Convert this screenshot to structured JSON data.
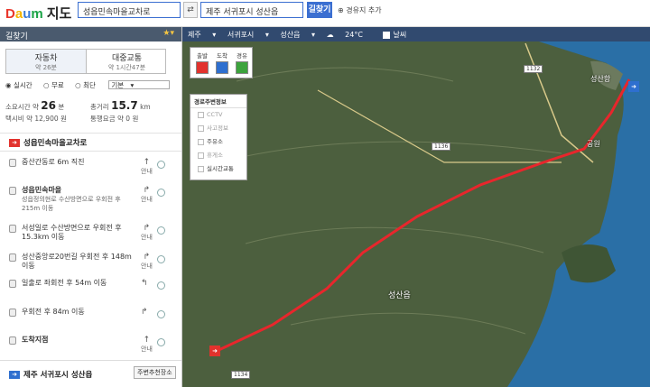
{
  "header": {
    "logo": {
      "d": "D",
      "a": "a",
      "u": "u",
      "m": "m"
    },
    "title": "지도",
    "origin_value": "성읍민속마을교차로",
    "destination_value": "제주 서귀포시 성산읍",
    "swap_icon": "swap-icon",
    "search_label": "길찾기",
    "add_waypoint_label": "경유지 추가"
  },
  "panel": {
    "title": "길찾기",
    "modes": [
      {
        "label": "자동차",
        "sub": "약 26분"
      },
      {
        "label": "대중교통",
        "sub": "약 1시간47분"
      }
    ],
    "options": {
      "realtime": "실시간",
      "free": "무료",
      "shortest": "최단",
      "select": "기본"
    },
    "stats": {
      "time_label": "소요시간",
      "time_pre": "약",
      "time_value": "26",
      "time_unit": "분",
      "dist_label": "총거리",
      "dist_value": "15.7",
      "dist_unit": "km",
      "taxi_label": "택시비",
      "taxi_value": "약 12,900 원",
      "toll_label": "통행요금",
      "toll_value": "약 0 원"
    },
    "start": "성읍민속마을교차로",
    "steps": [
      {
        "text": "중산간동로 6m 직진",
        "sub": "",
        "turn": "안내"
      },
      {
        "text": "성읍민속마을",
        "sub": "성읍정의현로 수산방면으로 우회전 후 215m 이동",
        "turn": "안내"
      },
      {
        "text": "서성일로 수산방면으로 우회전 후 15.3km 이동",
        "sub": "",
        "turn": "안내"
      },
      {
        "text": "성산중앙로20번길 우회전 후 148m 이동",
        "sub": "",
        "turn": "안내"
      },
      {
        "text": "일출로 좌회전 후 54m 이동",
        "sub": "",
        "turn": ""
      },
      {
        "text": "우회전 후 84m 이동",
        "sub": "",
        "turn": ""
      },
      {
        "text": "도착지점",
        "sub": "",
        "turn": "안내"
      }
    ],
    "end": "제주 서귀포시 성산읍",
    "nearby_label": "주변추천장소"
  },
  "map": {
    "topbar": {
      "region": "제주",
      "city": "서귀포시",
      "town": "성산읍",
      "weather": "24°C",
      "toggle": "날씨"
    },
    "legend": [
      "출발",
      "도착",
      "경유"
    ],
    "layer_title": "경로주변정보",
    "layers": [
      "CCTV",
      "사고정보",
      "주유소",
      "휴게소",
      "실시간교통"
    ],
    "labels": {
      "seongsan_port": "성산항",
      "park": "공원",
      "town": "성산읍",
      "road_1132": "1132",
      "road_1136": "1136",
      "road_1134": "1134"
    },
    "colors": {
      "route": "#e8262c",
      "start": "#e2322d",
      "end": "#2e6fcf",
      "land": "#50633f",
      "sea": "#2a6fa6"
    }
  }
}
